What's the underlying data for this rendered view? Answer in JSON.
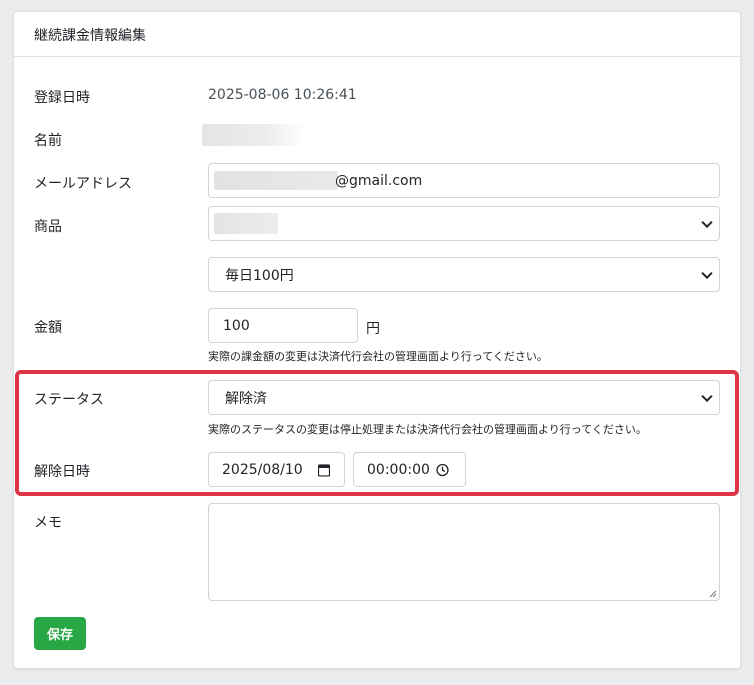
{
  "card": {
    "title": "継続課金情報編集"
  },
  "fields": {
    "registered": {
      "label": "登録日時",
      "value": "2025-08-06 10:26:41"
    },
    "name": {
      "label": "名前"
    },
    "email": {
      "label": "メールアドレス",
      "value_suffix": "@gmail.com"
    },
    "product": {
      "label": "商品",
      "plan_value": "毎日100円"
    },
    "amount": {
      "label": "金額",
      "value": "100",
      "unit": "円",
      "help": "実際の課金額の変更は決済代行会社の管理画面より行ってください。"
    },
    "status": {
      "label": "ステータス",
      "value": "解除済",
      "help": "実際のステータスの変更は停止処理または決済代行会社の管理画面より行ってください。"
    },
    "cancel_datetime": {
      "label": "解除日時",
      "date": "2025/08/10",
      "time": "00:00:00"
    },
    "memo": {
      "label": "メモ",
      "value": ""
    }
  },
  "actions": {
    "save_label": "保存"
  },
  "colors": {
    "accent_save": "#28a745",
    "highlight": "#dc3545",
    "background": "#ebecee"
  },
  "icons": [
    "chevron-down-icon",
    "calendar-icon",
    "clock-icon"
  ]
}
